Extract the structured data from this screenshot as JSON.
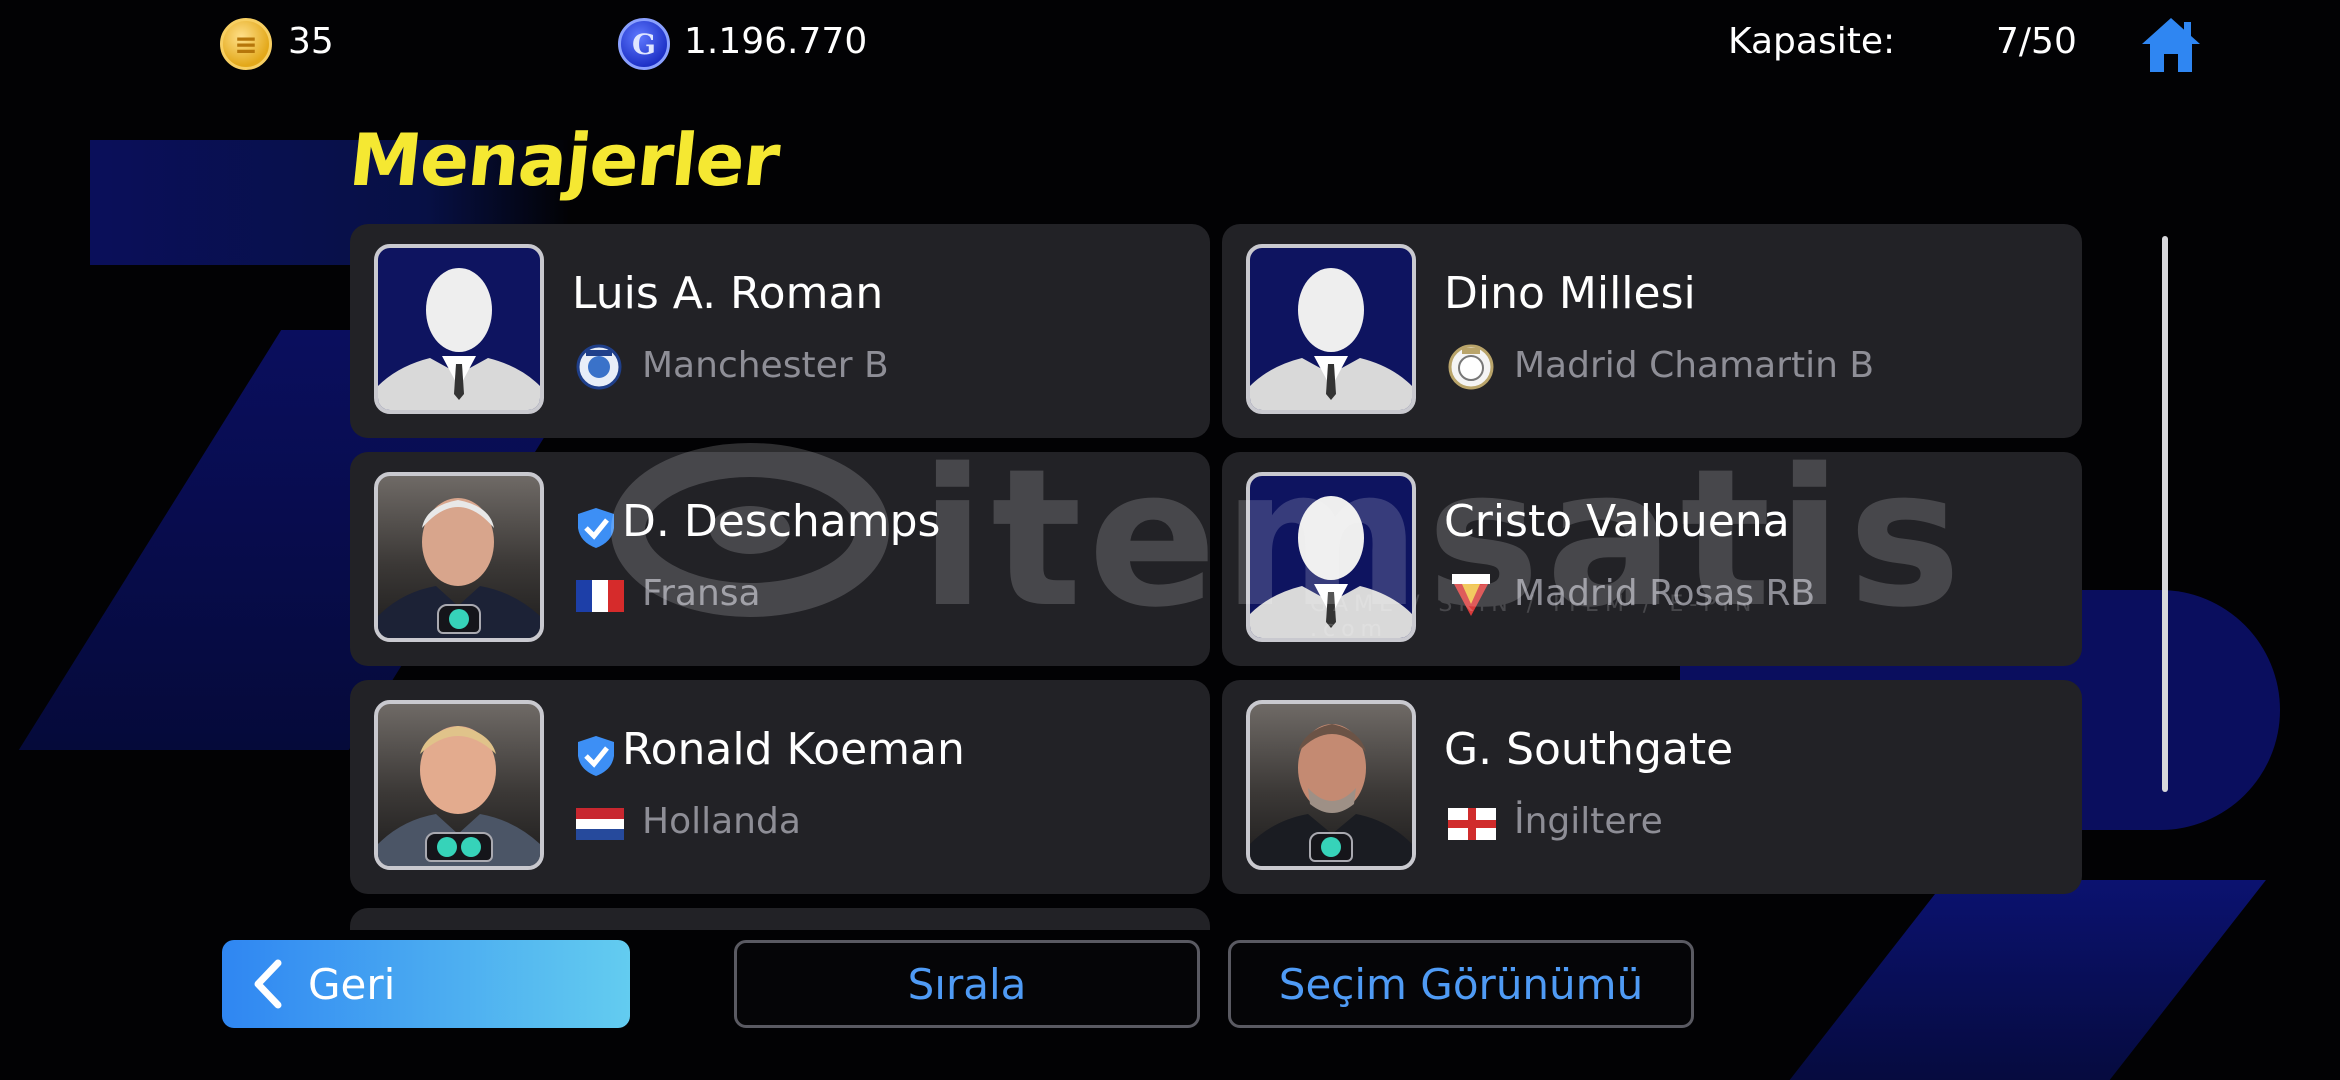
{
  "topbar": {
    "coins": "35",
    "gp": "1.196.770",
    "coin_icon_glyph": "≡",
    "gp_icon_glyph": "G",
    "capacity_label": "Kapasite:",
    "capacity_value": "7/50",
    "home_icon": "home-icon",
    "accent_color": "#2f86f2"
  },
  "page": {
    "title": "Menajerler"
  },
  "managers": [
    {
      "name": "Luis A. Roman",
      "team": "Manchester B",
      "verified": false,
      "avatar": "silhouette",
      "badges": 0
    },
    {
      "name": "Dino Millesi",
      "team": "Madrid Chamartin B",
      "verified": false,
      "avatar": "silhouette",
      "badges": 0
    },
    {
      "name": "D. Deschamps",
      "team": "Fransa",
      "verified": true,
      "avatar": "photo",
      "badges": 1,
      "flag": "france"
    },
    {
      "name": "Cristo Valbuena",
      "team": "Madrid Rosas RB",
      "verified": false,
      "avatar": "silhouette",
      "badges": 0
    },
    {
      "name": "Ronald Koeman",
      "team": "Hollanda",
      "verified": true,
      "avatar": "photo",
      "badges": 2,
      "flag": "netherlands"
    },
    {
      "name": "G. Southgate",
      "team": "İngiltere",
      "verified": false,
      "avatar": "photo",
      "badges": 1,
      "flag": "england"
    }
  ],
  "watermark": {
    "text": "itemsatis",
    "subtext": "GAME / SKIN / ITEM / E-PIN .com"
  },
  "buttons": {
    "back": "Geri",
    "sort": "Sırala",
    "view": "Seçim Görünümü"
  }
}
